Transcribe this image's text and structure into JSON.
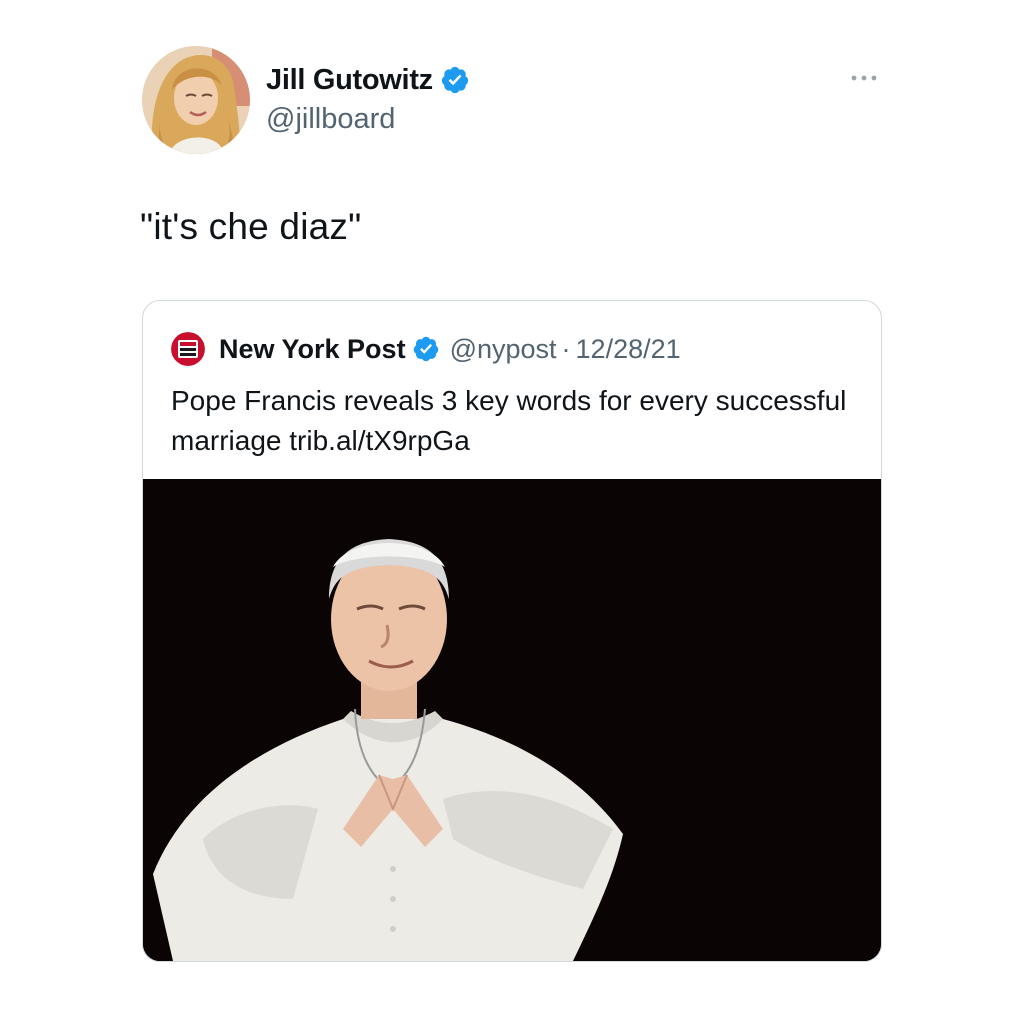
{
  "tweet": {
    "author": {
      "display_name": "Jill Gutowitz",
      "handle": "@jillboard",
      "verified": true,
      "avatar": "avatar-photo-woman-blonde-hair"
    },
    "text": "\"it's che diaz\"",
    "more_icon": "more-horizontal-icon"
  },
  "quote": {
    "author": {
      "display_name": "New York Post",
      "handle": "@nypost",
      "verified": true,
      "logo": "nyp-logo-icon"
    },
    "separator": "·",
    "date": "12/28/21",
    "text": "Pope Francis reveals 3 key words for every successful marriage trib.al/tX9rpGa",
    "media": "photo-pope-in-white-cassock-dark-background"
  },
  "colors": {
    "verified_blue": "#1d9bf0",
    "secondary_text": "#536471",
    "border": "#cfd9de",
    "nyp_red": "#c8102e",
    "media_bg": "#0b0405"
  }
}
